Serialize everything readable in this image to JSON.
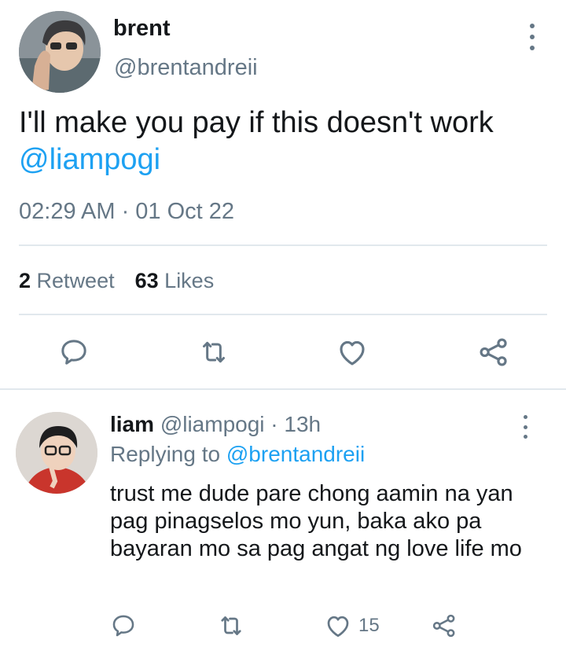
{
  "tweet": {
    "author_name": "brent",
    "author_handle": "@brentandreii",
    "text": "I'll make you pay if this doesn't work",
    "mention": "@liampogi",
    "timestamp": "02:29 AM · 01 Oct 22",
    "retweets_count": "2",
    "retweets_label": "Retweet",
    "likes_count": "63",
    "likes_label": "Likes"
  },
  "actions": [
    "comment-icon",
    "retweet-icon",
    "heart-icon",
    "share-icon"
  ],
  "reply": {
    "author_name": "liam",
    "author_handle": "@liampogi",
    "time": "· 13h",
    "replying_prefix": "Replying to",
    "replying_to": "@brentandreii",
    "text": "trust me dude pare chong aamin na yan pag pinagselos mo yun, baka ako pa bayaran mo sa pag angat ng love life mo",
    "likes": "15"
  },
  "colors": {
    "accent": "#1da1f2",
    "secondary_text": "#657786",
    "divider": "#e1e8ed"
  }
}
